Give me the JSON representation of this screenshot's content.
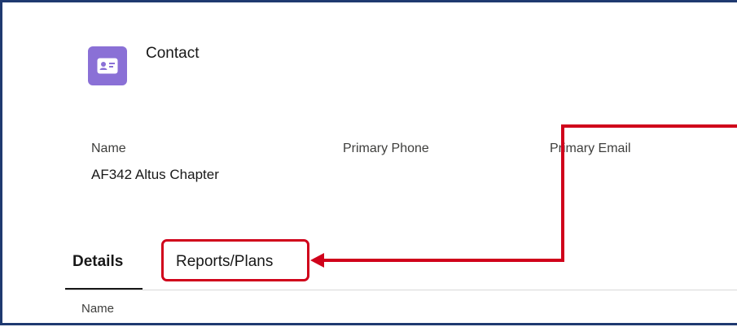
{
  "header": {
    "object_icon": "contact-card-icon",
    "object_label": "Contact"
  },
  "fields": [
    {
      "label": "Name",
      "value": "AF342 Altus Chapter"
    },
    {
      "label": "Primary Phone",
      "value": ""
    },
    {
      "label": "Primary Email",
      "value": ""
    }
  ],
  "tabs": [
    {
      "label": "Details",
      "active": true
    },
    {
      "label": "Reports/Plans",
      "active": false
    }
  ],
  "details_section": {
    "first_field_label": "Name"
  },
  "colors": {
    "icon_bg": "#8a70d6",
    "annotation_red": "#d0021b",
    "frame_border": "#1f3a70"
  }
}
